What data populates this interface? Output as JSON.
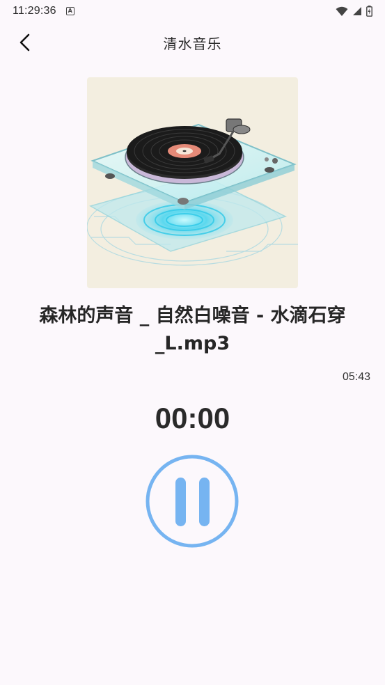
{
  "status_bar": {
    "time": "11:29:36",
    "app_icon": "A"
  },
  "appbar": {
    "title": "清水音乐",
    "back_icon": "chevron-left-icon"
  },
  "player": {
    "track_title": "森林的声音 _ 自然白噪音 - 水滴石穿_L.mp3",
    "duration": "05:43",
    "elapsed": "00:00",
    "state_icon": "pause-icon",
    "accent_color": "#76b4f1"
  }
}
